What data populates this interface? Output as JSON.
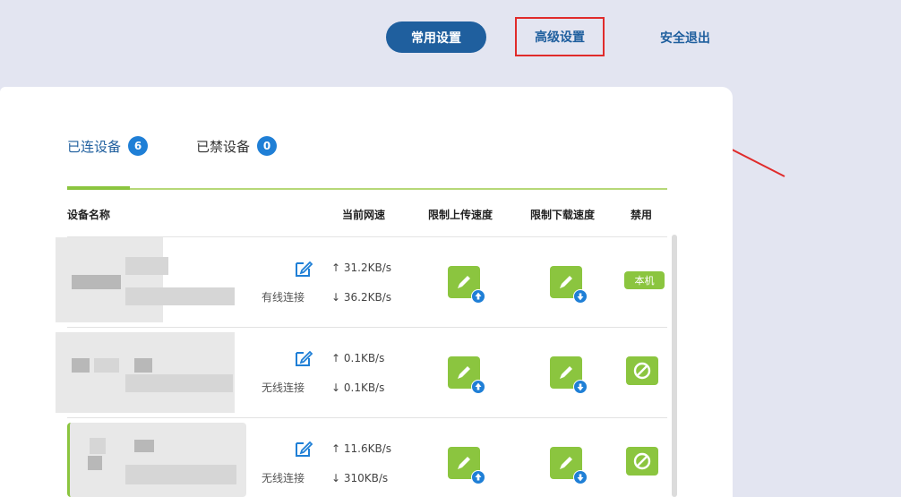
{
  "nav": {
    "common_settings": "常用设置",
    "advanced_settings": "高级设置",
    "logout": "安全退出"
  },
  "tabs": [
    {
      "label": "已连设备",
      "count": "6"
    },
    {
      "label": "已禁设备",
      "count": "0"
    }
  ],
  "table": {
    "headers": {
      "device_name": "设备名称",
      "current_speed": "当前网速",
      "limit_upload": "限制上传速度",
      "limit_download": "限制下载速度",
      "disable": "禁用"
    },
    "rows": [
      {
        "connection": "有线连接",
        "up": "↑ 31.2KB/s",
        "down": "↓ 36.2KB/s",
        "status": "本机"
      },
      {
        "connection": "无线连接",
        "up": "↑ 0.1KB/s",
        "down": "↓ 0.1KB/s",
        "status": "ban"
      },
      {
        "connection": "无线连接",
        "up": "↑ 11.6KB/s",
        "down": "↓ 310KB/s",
        "status": "ban"
      }
    ]
  },
  "colors": {
    "accent_blue": "#1f5f9e",
    "accent_green": "#8bc53f",
    "highlight_red": "#e02b2b",
    "background": "#e3e5f1"
  }
}
